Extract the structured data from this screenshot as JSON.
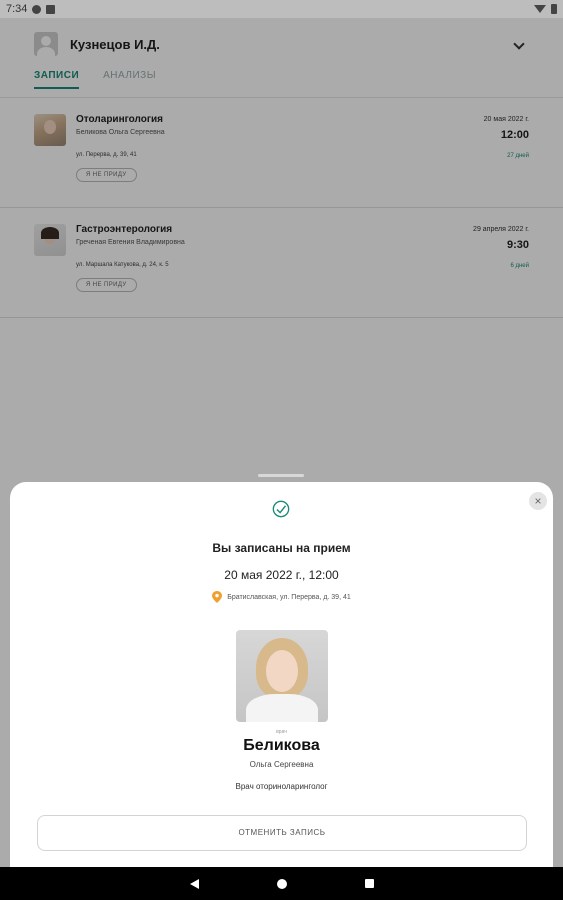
{
  "status_bar": {
    "time": "7:34"
  },
  "header": {
    "user_name": "Кузнецов И.Д.",
    "tabs": [
      {
        "label": "ЗАПИСИ",
        "active": true
      },
      {
        "label": "АНАЛИЗЫ",
        "active": false
      }
    ]
  },
  "appointments": [
    {
      "specialty": "Отоларингология",
      "doctor": "Беликова Ольга Сергеевна",
      "address": "ул. Перерва, д. 39, 41",
      "cancel_label": "Я НЕ ПРИДУ",
      "date": "20 мая 2022 г.",
      "time": "12:00",
      "days_left": "27 дней"
    },
    {
      "specialty": "Гастроэнтерология",
      "doctor": "Греченая Евгения Владимировна",
      "address": "ул. Маршала Катукова, д. 24, к. 5",
      "cancel_label": "Я НЕ ПРИДУ",
      "date": "29 апреля 2022 г.",
      "time": "9:30",
      "days_left": "6 дней"
    }
  ],
  "sheet": {
    "title": "Вы записаны на прием",
    "datetime": "20 мая 2022 г., 12:00",
    "address": "Братиславская, ул. Перерва, д. 39, 41",
    "role_small": "врач",
    "last_name": "Беликова",
    "first_name": "Ольга Сергеевна",
    "position": "Врач оториноларинголог",
    "cancel_button": "ОТМЕНИТЬ ЗАПИСЬ",
    "close": "×"
  },
  "colors": {
    "accent": "#1a8a78",
    "pin": "#f0a030"
  }
}
